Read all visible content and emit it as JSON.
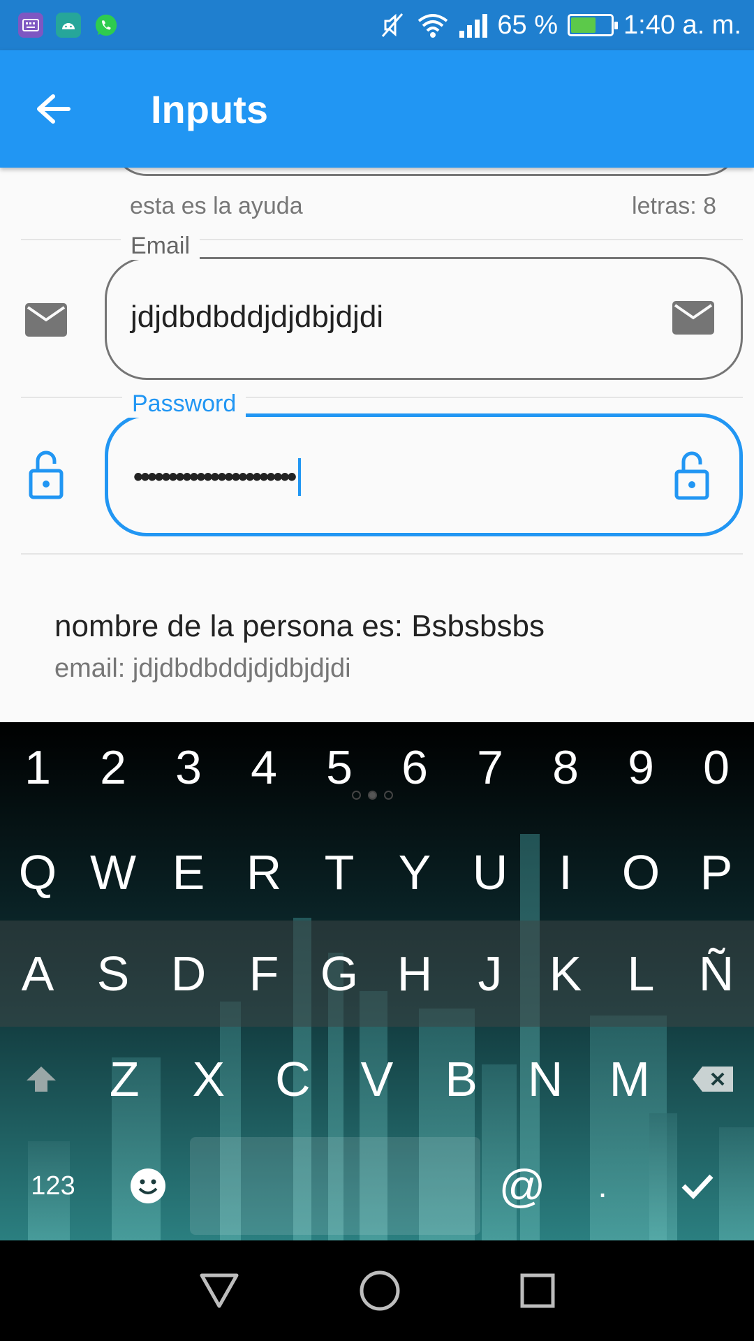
{
  "status_bar": {
    "battery_percent_text": "65 %",
    "battery_level": 0.65,
    "time": "1:40 a. m.",
    "left_icons": [
      "keyboard-app-icon",
      "android-app-icon",
      "whatsapp-icon"
    ],
    "right_icons": [
      "muted-icon",
      "wifi-icon",
      "signal-icon",
      "battery-charging-icon"
    ]
  },
  "app_bar": {
    "title": "Inputs",
    "back_icon": "arrow-back-icon",
    "color": "#2196f3"
  },
  "form": {
    "previous_field": {
      "helper_text": "esta es la ayuda",
      "counter_text": "letras: 8"
    },
    "email_field": {
      "label": "Email",
      "value": "jdjdbdbddjdjdbjdjdi",
      "prefix_icon": "email-icon",
      "suffix_icon": "email-icon"
    },
    "password_field": {
      "label": "Password",
      "masked_value": "•••••••••••••••••••••••",
      "prefix_icon": "lock-open-icon",
      "suffix_icon": "lock-open-icon",
      "focused": true
    }
  },
  "summary": {
    "name_line": "nombre de la persona es: Bsbsbsbs",
    "email_line": "email: jdjdbdbddjdjdbjdjdi"
  },
  "keyboard": {
    "number_row": [
      "1",
      "2",
      "3",
      "4",
      "5",
      "6",
      "7",
      "8",
      "9",
      "0"
    ],
    "row1": [
      "Q",
      "W",
      "E",
      "R",
      "T",
      "Y",
      "U",
      "I",
      "O",
      "P"
    ],
    "row2": [
      "A",
      "S",
      "D",
      "F",
      "G",
      "H",
      "J",
      "K",
      "L",
      "Ñ"
    ],
    "row3": [
      "Z",
      "X",
      "C",
      "V",
      "B",
      "N",
      "M"
    ],
    "symbols_key": "123",
    "at_key": "@",
    "period_key": ".",
    "shift_icon": "shift-icon",
    "backspace_icon": "backspace-icon",
    "emoji_icon": "emoji-icon",
    "done_icon": "check-icon"
  },
  "nav_bar": {
    "icons": [
      "back-triangle-icon",
      "home-circle-icon",
      "recents-square-icon"
    ]
  }
}
